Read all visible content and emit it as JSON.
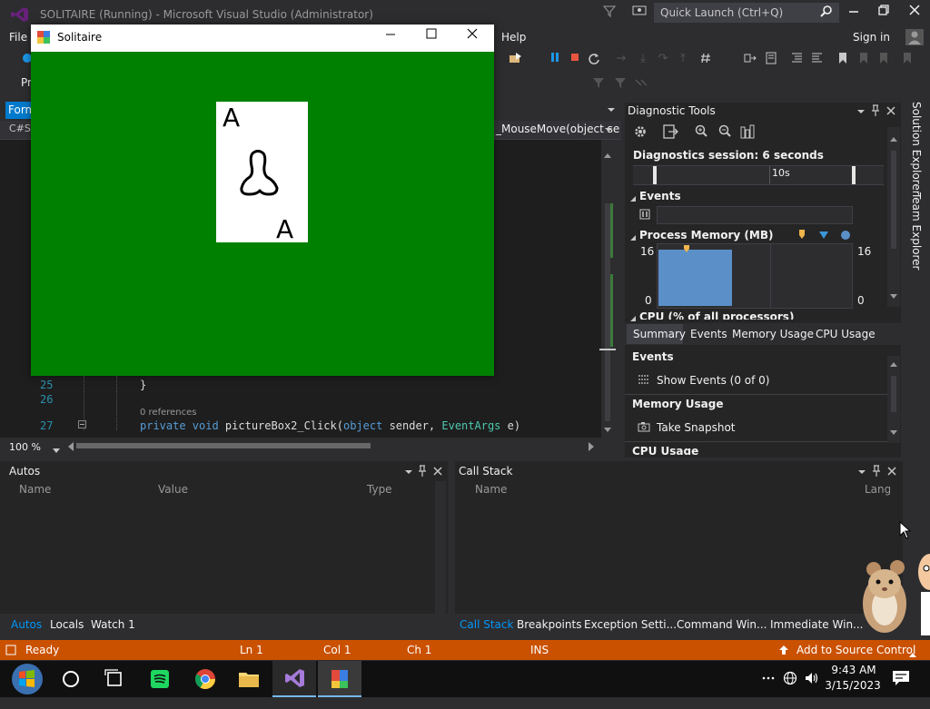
{
  "vs": {
    "title": "SOLITAIRE (Running) - Microsoft Visual Studio  (Administrator)",
    "quick_launch_placeholder": "Quick Launch (Ctrl+Q)",
    "menu": [
      "File",
      "Help"
    ],
    "signin": "Sign in",
    "form_tab": "Form",
    "nav_right": "_MouseMove(object se",
    "zoom": "100 %",
    "toolbar_left_label": "Pr"
  },
  "editor": {
    "lines": [
      {
        "num": "25",
        "code": "}"
      },
      {
        "num": "26",
        "code": ""
      },
      {
        "num": "",
        "refs": "0 references"
      },
      {
        "num": "27",
        "kw": "private void",
        "name": " pictureBox2_Click(",
        "p1kw": "object",
        "p1": " sender, ",
        "p2type": "EventArgs",
        "p2": " e)"
      }
    ]
  },
  "diagnostic": {
    "title": "Diagnostic Tools",
    "session": "Diagnostics session: 6 seconds",
    "timeline_label": "10s",
    "events_label": "Events",
    "process_memory_label": "Process Memory (MB)",
    "mem_max_left": "16",
    "mem_max_right": "16",
    "mem_min_left": "0",
    "mem_min_right": "0",
    "cpu_label": "CPU (% of all processors)",
    "tabs": [
      "Summary",
      "Events",
      "Memory Usage",
      "CPU Usage"
    ],
    "summary": {
      "events_head": "Events",
      "show_events": "Show Events (0 of 0)",
      "memory_head": "Memory Usage",
      "take_snapshot": "Take Snapshot",
      "cpu_head": "CPU Usage"
    }
  },
  "side_tabs": [
    "Solution Explorer",
    "Team Explorer"
  ],
  "autos": {
    "title": "Autos",
    "columns": [
      "Name",
      "Value",
      "Type"
    ],
    "tabs": [
      "Autos",
      "Locals",
      "Watch 1"
    ]
  },
  "callstack": {
    "title": "Call Stack",
    "columns": [
      "Name",
      "Lang"
    ],
    "tabs": [
      "Call Stack",
      "Breakpoints",
      "Exception Setti...",
      "Command Win...",
      "Immediate Win..."
    ]
  },
  "status": {
    "ready": "Ready",
    "ln": "Ln 1",
    "col": "Col 1",
    "ch": "Ch 1",
    "ins": "INS",
    "source_control": "Add to Source Control"
  },
  "taskbar": {
    "time": "9:43 AM",
    "date": "3/15/2023"
  },
  "solitaire": {
    "title": "Solitaire",
    "felt_color": "#008000",
    "card": {
      "rank_top": "A",
      "rank_bottom": "A"
    }
  }
}
